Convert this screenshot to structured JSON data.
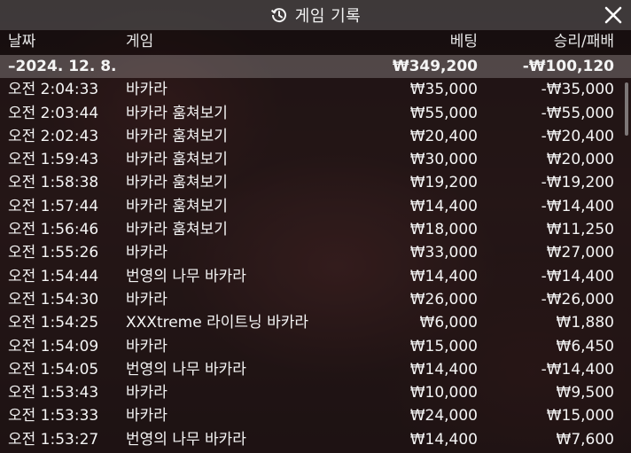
{
  "title": "게임 기록",
  "icons": {
    "history": "history-icon",
    "close": "close-icon"
  },
  "columns": {
    "date": "날짜",
    "game": "게임",
    "bet": "베팅",
    "result": "승리/패배"
  },
  "summary": {
    "date": "–2024. 12. 8.",
    "game": "",
    "bet": "₩349,200",
    "result": "-₩100,120"
  },
  "rows": [
    {
      "time": "오전 2:04:33",
      "game": "바카라",
      "bet": "₩35,000",
      "result": "-₩35,000"
    },
    {
      "time": "오전 2:03:44",
      "game": "바카라 훔쳐보기",
      "bet": "₩55,000",
      "result": "-₩55,000"
    },
    {
      "time": "오전 2:02:43",
      "game": "바카라 훔쳐보기",
      "bet": "₩20,400",
      "result": "-₩20,400"
    },
    {
      "time": "오전 1:59:43",
      "game": "바카라 훔쳐보기",
      "bet": "₩30,000",
      "result": "₩20,000"
    },
    {
      "time": "오전 1:58:38",
      "game": "바카라 훔쳐보기",
      "bet": "₩19,200",
      "result": "-₩19,200"
    },
    {
      "time": "오전 1:57:44",
      "game": "바카라 훔쳐보기",
      "bet": "₩14,400",
      "result": "-₩14,400"
    },
    {
      "time": "오전 1:56:46",
      "game": "바카라 훔쳐보기",
      "bet": "₩18,000",
      "result": "₩11,250"
    },
    {
      "time": "오전 1:55:26",
      "game": "바카라",
      "bet": "₩33,000",
      "result": "₩27,000"
    },
    {
      "time": "오전 1:54:44",
      "game": "번영의 나무 바카라",
      "bet": "₩14,400",
      "result": "-₩14,400"
    },
    {
      "time": "오전 1:54:30",
      "game": "바카라",
      "bet": "₩26,000",
      "result": "-₩26,000"
    },
    {
      "time": "오전 1:54:25",
      "game": "XXXtreme 라이트닝 바카라",
      "bet": "₩6,000",
      "result": "₩1,880"
    },
    {
      "time": "오전 1:54:09",
      "game": "바카라",
      "bet": "₩15,000",
      "result": "₩6,450"
    },
    {
      "time": "오전 1:54:05",
      "game": "번영의 나무 바카라",
      "bet": "₩14,400",
      "result": "-₩14,400"
    },
    {
      "time": "오전 1:53:43",
      "game": "바카라",
      "bet": "₩10,000",
      "result": "₩9,500"
    },
    {
      "time": "오전 1:53:33",
      "game": "바카라",
      "bet": "₩24,000",
      "result": "₩15,000"
    },
    {
      "time": "오전 1:53:27",
      "game": "번영의 나무 바카라",
      "bet": "₩14,400",
      "result": "₩7,600"
    }
  ]
}
